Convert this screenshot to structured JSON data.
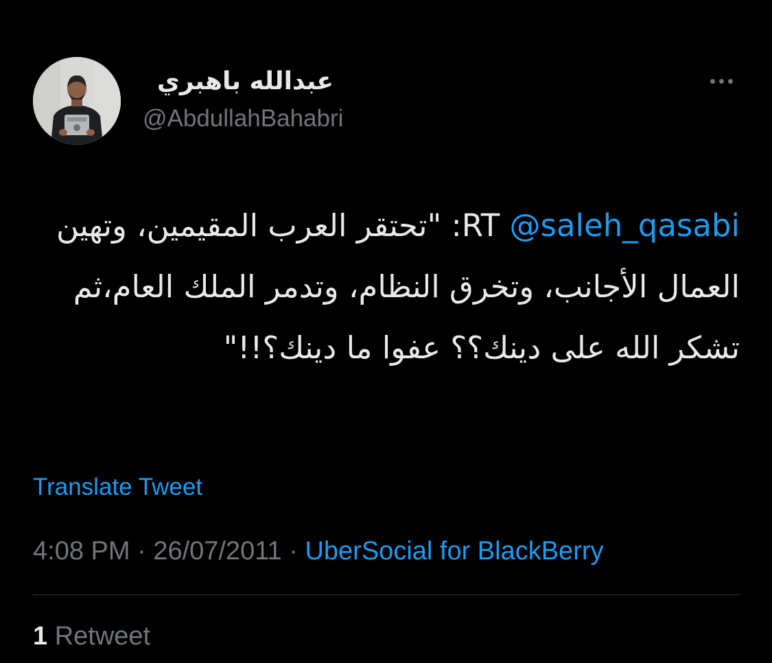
{
  "author": {
    "display_name": "عبدالله باهبري",
    "handle": "@AbdullahBahabri",
    "avatar_icon": "profile-photo"
  },
  "menu": {
    "icon": "more-horizontal-icon"
  },
  "tweet": {
    "prefix": "RT ",
    "mention": "@saleh_qasabi",
    "body": ": \"تحتقر العرب المقيمين، وتهين العمال الأجانب، وتخرق النظام، وتدمر الملك العام،ثم تشكر الله على دينك؟؟ عفوا ما دينك؟!!\""
  },
  "translate_label": "Translate Tweet",
  "meta": {
    "time": "4:08 PM",
    "separator1": " · ",
    "date": "26/07/2011",
    "separator2": " · ",
    "source": "UberSocial for BlackBerry"
  },
  "stats": {
    "retweet_count": "1",
    "retweet_label": " Retweet"
  },
  "colors": {
    "background": "#000000",
    "text": "#e7e9ea",
    "secondary": "#71767b",
    "accent": "#1d9bf0",
    "divider": "#2f3336"
  }
}
